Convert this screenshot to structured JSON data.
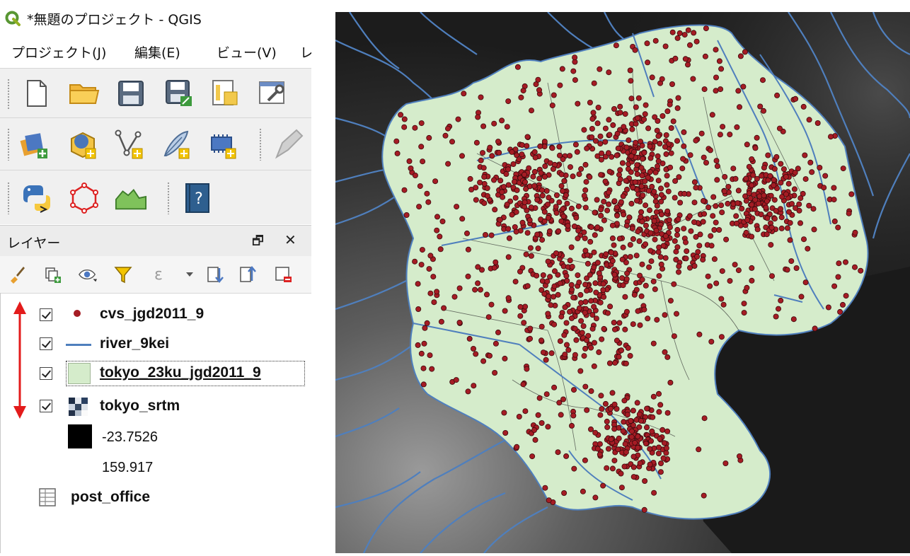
{
  "window": {
    "title": "*無題のプロジェクト - QGIS"
  },
  "menu": {
    "items": [
      "プロジェクト(J)",
      "編集(E)",
      "ビュー(V)",
      "レ"
    ]
  },
  "layers_panel": {
    "title": "レイヤー",
    "float_icon": "🗗",
    "close_icon": "✕",
    "layers": [
      {
        "name": "cvs_jgd2011_9",
        "checked": true,
        "symbol": "point",
        "color": "#a51c24"
      },
      {
        "name": "river_9kei",
        "checked": true,
        "symbol": "line",
        "color": "#4f7fbd"
      },
      {
        "name": "tokyo_23ku_jgd2011_9",
        "checked": true,
        "symbol": "polygon",
        "color": "#d5eccb",
        "selected": true
      },
      {
        "name": "tokyo_srtm",
        "checked": true,
        "symbol": "raster",
        "legend": {
          "min": "-23.7526",
          "max": "159.917"
        }
      },
      {
        "name": "post_office",
        "checked": false,
        "symbol": "table"
      }
    ]
  },
  "map": {
    "background": "#0f0f0f",
    "ward_fill": "#d5eccb",
    "river_color": "#4f7fbd",
    "point_color": "#a51c24"
  },
  "annotation": {
    "color": "#e31b1b",
    "icon": "double-arrow-vertical"
  }
}
